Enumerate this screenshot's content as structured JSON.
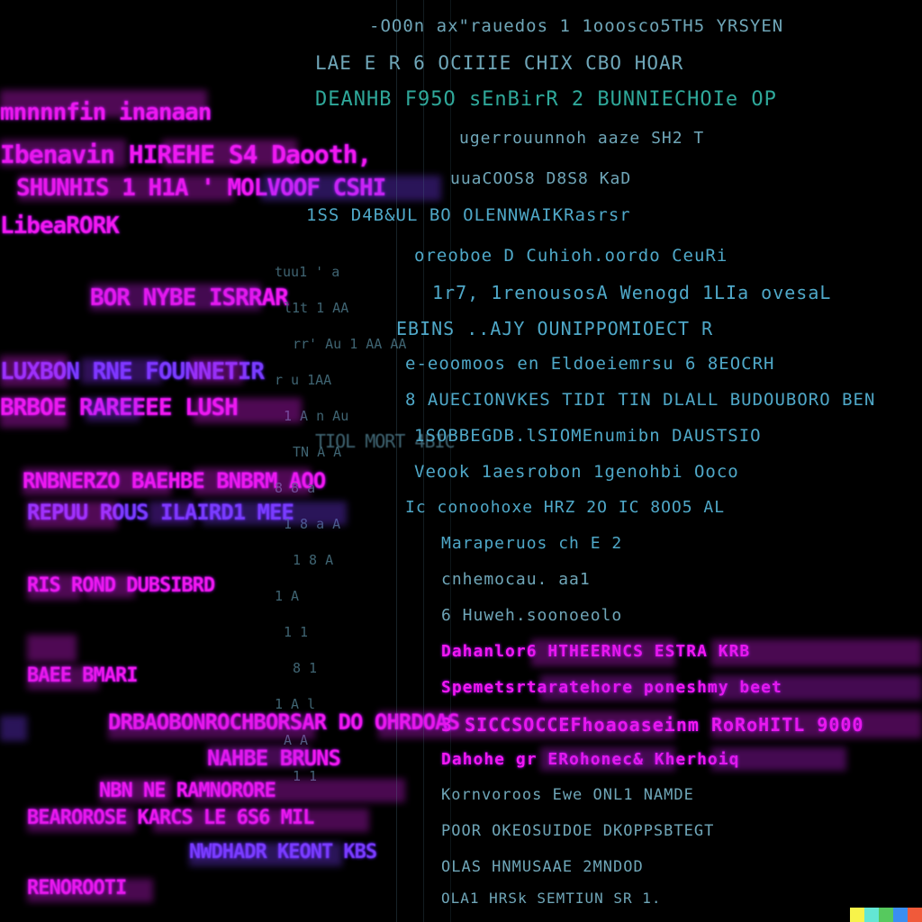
{
  "palette": {
    "background": "#000000",
    "pink": "#f218f0",
    "violet": "#7a3cff",
    "teal": "#6fa6b8",
    "green": "#2fa89a"
  },
  "right_lines": [
    "-OO0n  ax\"rauedos 1 1ooosco5TH5 YRSYEN",
    "LAE  E R  6 OCIIIE  CHIX  CBO  HOAR",
    "DEANHB F95O sEnBirR 2 BUNNIECHOIe  OP",
    "ugerrouunnoh  aaze  SH2 T",
    "uuaCOOS8  D8S8 KaD",
    "1SS  D4B&UL  BO OLENNWAIKRasrsr",
    "oreoboe  D  Cuhioh.oordo  CeuRi",
    "1r7, 1renousosA Wenogd  1LIa  ovesaL",
    "EBINS  ..AJY  OUNIPPOMIOECT  R",
    "e-eoomoos en Eldoeiemrsu  6 8EOCRH",
    "8 AUECIONVKES TIDI TIN DLALL BUDOUBORO BEN",
    "1SOBBEGDB.lSIOMEnumibn  DAUSTSIO",
    "Veook 1aesrobon  1genohbi  Ooco",
    "Ic conoohoxe HRZ  2O  IC  8OO5  AL",
    "Maraperuos ch E 2",
    "cnhemocau. aa1",
    "6 Huweh.soonoeolo",
    "Dahanlor6 HTHEERNCS  ESTRA KRB",
    "Spemetsrtaratehore  poneshmy  beet",
    "3 SICCSOCCEFhoaoaseinm  RoRoHITL 9000",
    "Dahohe gr ERohonec&  Kherhoiq",
    "Kornvoroos Ewe  ONL1 NAMDE",
    "POOR OKEOSUIDOE  DKOPPSBTEGT",
    "OLAS HNMUSAAE  2MNDOD",
    "OLA1 HRSk SEMTIUN SR 1."
  ],
  "left_lines": [
    "mnnnnfin inanaan",
    "Ibenavin  HIREHE  S4  Daooth,",
    "SHUNHIS 1 H1A  ' MOLVOOF CSHI",
    "LibeaRORK",
    "BOR NYBE ISRRAR",
    "LUXBON  RNE  FOUNNETIR",
    "BRBOE  RAREEEE  LUSH",
    "TIOL  MORT  4BIC",
    "RNBNERZO  BAEHBE  BNBRM  AOO",
    "REPUU  ROUS  ILAIRD1 MEE",
    "RIS  ROND  DUBSIBRD",
    "BAEE  BMARI",
    "DRBAOBONROCHBORSAR  DO  OHRDOAS",
    "NAHBE  BRUNS",
    "NBN  NE  RAMNORORE",
    "BEAROROSE  KARCS  LE  6S6  MIL",
    "NWDHADR  KEONT KBS",
    "RENOROOTI"
  ],
  "faint_lines": [
    "tuu1  '  a",
    "l1t  1  AA",
    "rr' Au  1 AA   AA",
    "r  u  1AA",
    "1  A  n  Au",
    "TN  A  A",
    "8  8  a",
    "1  8  a  A",
    "1  8  A",
    "1  A",
    "1  1",
    "8  1",
    "1  A  l",
    "A  A",
    "1  1"
  ]
}
